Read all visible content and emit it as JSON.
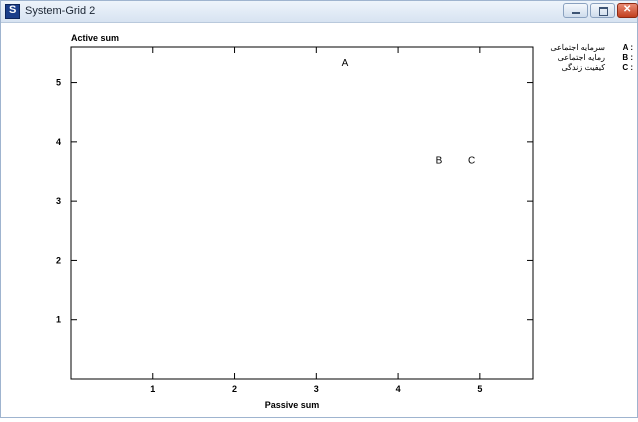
{
  "window": {
    "title": "System-Grid 2"
  },
  "legend": [
    {
      "key": "A :",
      "name": "سرمایه اجتماعی"
    },
    {
      "key": "B :",
      "name": "رمایه اجتماعی"
    },
    {
      "key": "C :",
      "name": "کیفیت زندگی"
    }
  ],
  "chart_data": {
    "type": "scatter",
    "xlabel": "Passive sum",
    "ylabel": "Active sum",
    "xlim": [
      0,
      5.65
    ],
    "ylim": [
      0,
      5.6
    ],
    "xticks": [
      1,
      2,
      3,
      4,
      5
    ],
    "yticks": [
      1,
      2,
      3,
      4,
      5
    ],
    "points": [
      {
        "label": "A",
        "x": 3.35,
        "y": 5.35
      },
      {
        "label": "B",
        "x": 4.5,
        "y": 3.7
      },
      {
        "label": "C",
        "x": 4.9,
        "y": 3.7
      }
    ],
    "grid": false,
    "legend_position": "top-right"
  }
}
